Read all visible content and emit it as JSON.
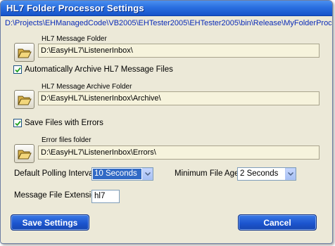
{
  "window": {
    "title": "HL7 Folder Processor Settings",
    "config_path": "D:\\Projects\\EHManagedCode\\VB2005\\EHTester2005\\EHTester2005\\bin\\Release\\MyFolderProcessor.ini"
  },
  "message_folder": {
    "label": "HL7 Message Folder",
    "value": "D:\\EasyHL7\\ListenerInbox\\",
    "button_icon": "folder-open-icon"
  },
  "auto_archive": {
    "label": "Automatically Archive HL7 Message Files",
    "checked": true
  },
  "archive_folder": {
    "label": "HL7 Message Archive Folder",
    "value": "D:\\EasyHL7\\ListenerInbox\\Archive\\",
    "button_icon": "folder-open-icon"
  },
  "save_errors": {
    "label": "Save Files with Errors",
    "checked": true
  },
  "error_folder": {
    "label": "Error files folder",
    "value": "D:\\EasyHL7\\ListenerInbox\\Errors\\",
    "button_icon": "folder-open-icon"
  },
  "polling": {
    "label": "Default Polling Interval",
    "selected": "10 Seconds"
  },
  "min_age": {
    "label": "Minimum File Age",
    "selected": "2 Seconds"
  },
  "extension": {
    "label": "Message File Extension",
    "value": "hl7"
  },
  "buttons": {
    "save": "Save Settings",
    "cancel": "Cancel"
  },
  "colors": {
    "title_bar": "#2a6fe0",
    "path_text": "#0a2bb8",
    "button_blue": "#1c55cf",
    "field_background": "#f6f3dc"
  }
}
